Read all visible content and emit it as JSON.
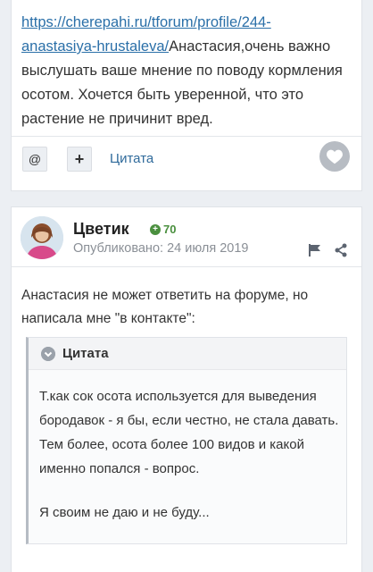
{
  "post1": {
    "link_text": "https://cherepahi.ru/tforum/profile/244-anastasiya-hrustaleva/",
    "body_text": "Анастасия,очень важно выслушать ваше мнение по поводу кормления осотом. Хочется быть уверенной, что это растение не причинит вред.",
    "mention_label": "@",
    "multiquote_label": "+",
    "quote_label": "Цитата"
  },
  "post2": {
    "author_name": "Цветик",
    "reputation": "70",
    "published_label": "Опубликовано:",
    "published_date": "24 июля 2019",
    "body_text": "Анастасия не может ответить на форуме, но написала мне \"в контакте\":",
    "quote": {
      "title": "Цитата",
      "paragraph1": "Т.как сок осота используется для выведения бородавок - я бы, если честно, не стала давать. Тем более, осота более 100 видов и какой именно попался - вопрос.",
      "paragraph2": "Я своим не даю и не буду..."
    }
  },
  "icons": {
    "like": "heart-icon",
    "flag": "flag-icon",
    "share": "share-icon",
    "rep": "plus-circle-icon",
    "toggle": "chevron-down-icon"
  },
  "colors": {
    "link": "#2a6fa8",
    "quote_link": "#2f6a9b",
    "reputation": "#4a8f3e",
    "like_bg": "#b7bcc3",
    "page_bg": "#eceff3"
  }
}
